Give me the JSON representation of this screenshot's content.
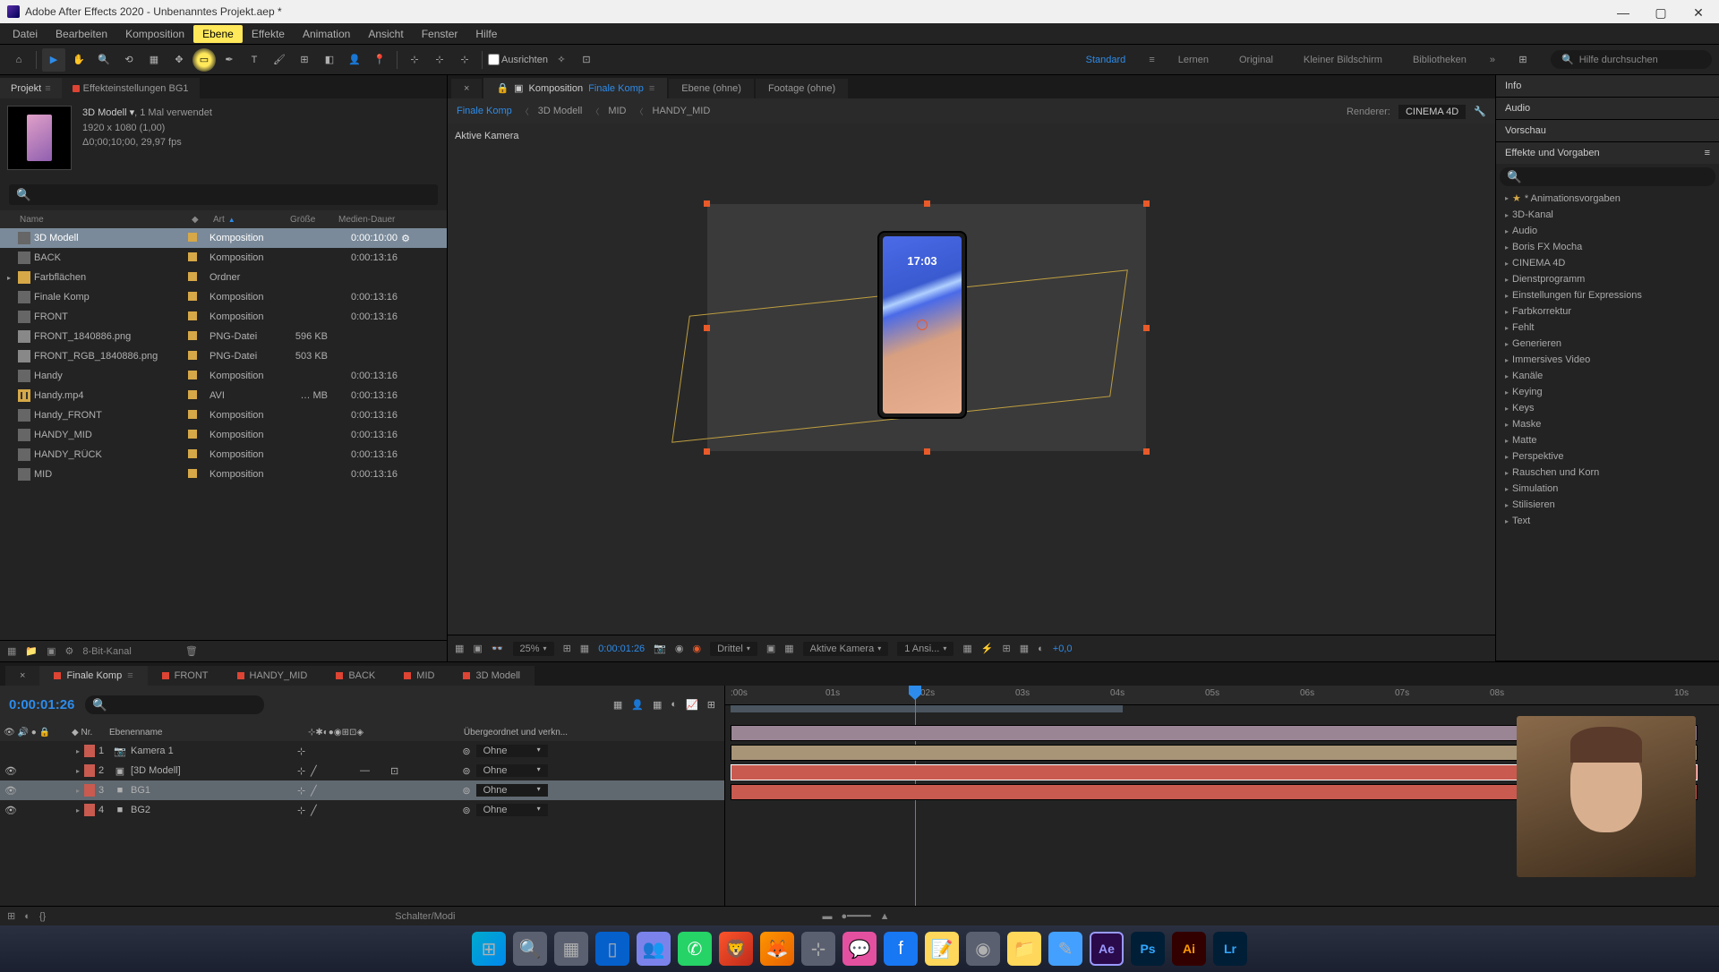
{
  "window": {
    "title": "Adobe After Effects 2020 - Unbenanntes Projekt.aep *"
  },
  "menu": [
    "Datei",
    "Bearbeiten",
    "Komposition",
    "Ebene",
    "Effekte",
    "Animation",
    "Ansicht",
    "Fenster",
    "Hilfe"
  ],
  "toolbar": {
    "snap_label": "Ausrichten",
    "workspaces": [
      "Standard",
      "Lernen",
      "Original",
      "Kleiner Bildschirm",
      "Bibliotheken"
    ],
    "search_placeholder": "Hilfe durchsuchen"
  },
  "project": {
    "tab_project": "Projekt",
    "tab_effectcontrols": "Effekteinstellungen BG1",
    "selected_name": "3D Modell ▾",
    "selected_usage": ", 1 Mal verwendet",
    "selected_res": "1920 x 1080 (1,00)",
    "selected_dur": "Δ0;00;10;00, 29,97 fps",
    "col_name": "Name",
    "col_type": "Art",
    "col_size": "Größe",
    "col_dur": "Medien-Dauer",
    "items": [
      {
        "name": "3D Modell",
        "type": "Komposition",
        "size": "",
        "dur": "0:00:10:00",
        "icon": "comp",
        "sel": true,
        "extra": "⚙"
      },
      {
        "name": "BACK",
        "type": "Komposition",
        "size": "",
        "dur": "0:00:13:16",
        "icon": "comp"
      },
      {
        "name": "Farbflächen",
        "type": "Ordner",
        "size": "",
        "dur": "",
        "icon": "folder",
        "twisty": true
      },
      {
        "name": "Finale Komp",
        "type": "Komposition",
        "size": "",
        "dur": "0:00:13:16",
        "icon": "comp"
      },
      {
        "name": "FRONT",
        "type": "Komposition",
        "size": "",
        "dur": "0:00:13:16",
        "icon": "comp"
      },
      {
        "name": "FRONT_1840886.png",
        "type": "PNG-Datei",
        "size": "596 KB",
        "dur": "",
        "icon": "png"
      },
      {
        "name": "FRONT_RGB_1840886.png",
        "type": "PNG-Datei",
        "size": "503 KB",
        "dur": "",
        "icon": "png"
      },
      {
        "name": "Handy",
        "type": "Komposition",
        "size": "",
        "dur": "0:00:13:16",
        "icon": "comp"
      },
      {
        "name": "Handy.mp4",
        "type": "AVI",
        "size": "… MB",
        "dur": "0:00:13:16",
        "icon": "avi"
      },
      {
        "name": "Handy_FRONT",
        "type": "Komposition",
        "size": "",
        "dur": "0:00:13:16",
        "icon": "comp"
      },
      {
        "name": "HANDY_MID",
        "type": "Komposition",
        "size": "",
        "dur": "0:00:13:16",
        "icon": "comp"
      },
      {
        "name": "HANDY_RÜCK",
        "type": "Komposition",
        "size": "",
        "dur": "0:00:13:16",
        "icon": "comp"
      },
      {
        "name": "MID",
        "type": "Komposition",
        "size": "",
        "dur": "0:00:13:16",
        "icon": "comp"
      }
    ],
    "footer_depth": "8-Bit-Kanal"
  },
  "viewer": {
    "tab_comp_prefix": "Komposition",
    "tab_comp_name": "Finale Komp",
    "tab_layer": "Ebene (ohne)",
    "tab_footage": "Footage (ohne)",
    "crumbs": [
      "Finale Komp",
      "3D Modell",
      "MID",
      "HANDY_MID"
    ],
    "renderer_label": "Renderer:",
    "renderer_value": "CINEMA 4D",
    "camera_label": "Aktive Kamera",
    "phone_time": "17:03",
    "footer": {
      "zoom": "25%",
      "timecode": "0:00:01:26",
      "res": "Drittel",
      "camera": "Aktive Kamera",
      "views": "1 Ansi...",
      "adjust": "+0,0"
    }
  },
  "right": {
    "info": "Info",
    "audio": "Audio",
    "preview": "Vorschau",
    "effects_header": "Effekte und Vorgaben",
    "effects": [
      "* Animationsvorgaben",
      "3D-Kanal",
      "Audio",
      "Boris FX Mocha",
      "CINEMA 4D",
      "Dienstprogramm",
      "Einstellungen für Expressions",
      "Farbkorrektur",
      "Fehlt",
      "Generieren",
      "Immersives Video",
      "Kanäle",
      "Keying",
      "Keys",
      "Maske",
      "Matte",
      "Perspektive",
      "Rauschen und Korn",
      "Simulation",
      "Stilisieren",
      "Text"
    ]
  },
  "timeline": {
    "tabs": [
      "Finale Komp",
      "FRONT",
      "HANDY_MID",
      "BACK",
      "MID",
      "3D Modell"
    ],
    "timecode": "0:00:01:26",
    "col_nr": "Nr.",
    "col_name": "Ebenenname",
    "col_parent": "Übergeordnet und verkn...",
    "ruler": [
      ":00s",
      "01s",
      "02s",
      "03s",
      "04s",
      "05s",
      "06s",
      "07s",
      "08s",
      "10s"
    ],
    "layers": [
      {
        "nr": "1",
        "name": "Kamera 1",
        "color": "#c85a50",
        "icon": "📷",
        "parent": "Ohne"
      },
      {
        "nr": "2",
        "name": "[3D Modell]",
        "color": "#c85a50",
        "icon": "▣",
        "parent": "Ohne",
        "threed": true
      },
      {
        "nr": "3",
        "name": "BG1",
        "color": "#c85a50",
        "icon": "■",
        "parent": "Ohne",
        "sel": true
      },
      {
        "nr": "4",
        "name": "BG2",
        "color": "#c85a50",
        "icon": "■",
        "parent": "Ohne"
      }
    ],
    "footer_mode": "Schalter/Modi"
  },
  "taskbar": {
    "ae": "Ae",
    "ps": "Ps",
    "ai": "Ai",
    "lr": "Lr"
  }
}
